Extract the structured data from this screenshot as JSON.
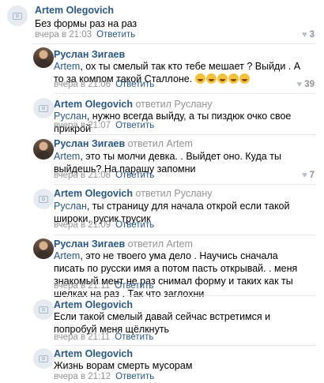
{
  "comments": [
    {
      "author": "Artem Olegovich",
      "text": "Без формы раз на раз",
      "time": "вчера в 21:03",
      "reply": "Ответить",
      "likes": "3",
      "heart": "♥"
    },
    {
      "author": "Руслан Зигаев",
      "mention": "Artem",
      "text": ", ох ты смелый так кто тебе мешает ? Выйди . А то за компом такой Сталлоне.",
      "time": "вчера в 21:06",
      "reply": "Ответить",
      "likes": "39",
      "heart": "♥",
      "emoji_count": 5
    },
    {
      "author": "Artem Olegovich",
      "replied": " ответил Руслану",
      "mention": "Руслан",
      "text": ", нужно всегда выйду, а ты пиздюк очко свое прикрой",
      "time": "вчера в 21:07",
      "reply": "Ответить"
    },
    {
      "author": "Руслан Зигаев",
      "replied": " ответил Artem",
      "mention": "Artem",
      "text": ", это ты молчи девка. . Выйдет оно. Куда ты выйдешь? На парашу запомни",
      "time": "вчера в 21:08",
      "reply": "Ответить",
      "likes": "7",
      "heart": "♥"
    },
    {
      "author": "Artem Olegovich",
      "replied": " ответил Руслану",
      "mention": "Руслан",
      "text": ", ты страницу для начала открой если такой широки, русик трусик",
      "time": "вчера в 21:09",
      "reply": "Ответить"
    },
    {
      "author": "Руслан Зигаев",
      "replied": " ответил Artem",
      "mention": "Artem",
      "text": ", это не твоего ума дело . Научись сначала писать по русски имя а потом пасть открывай. . меня знакомый мент не раз снимал форму и таких как ты шелках на раз . Так что заглохни",
      "time": "вчера в 21:11",
      "reply": "Ответить"
    },
    {
      "author": "Artem Olegovich",
      "text": "Если такой смелый давай сейчас встретимся и попробуй меня щёлкнуть",
      "time": "вчера в 21:11",
      "reply": "Ответить"
    },
    {
      "author": "Artem Olegovich",
      "text": "Жизнь ворам смерть мусорам",
      "time": "вчера в 21:12",
      "reply": "Ответить"
    }
  ]
}
